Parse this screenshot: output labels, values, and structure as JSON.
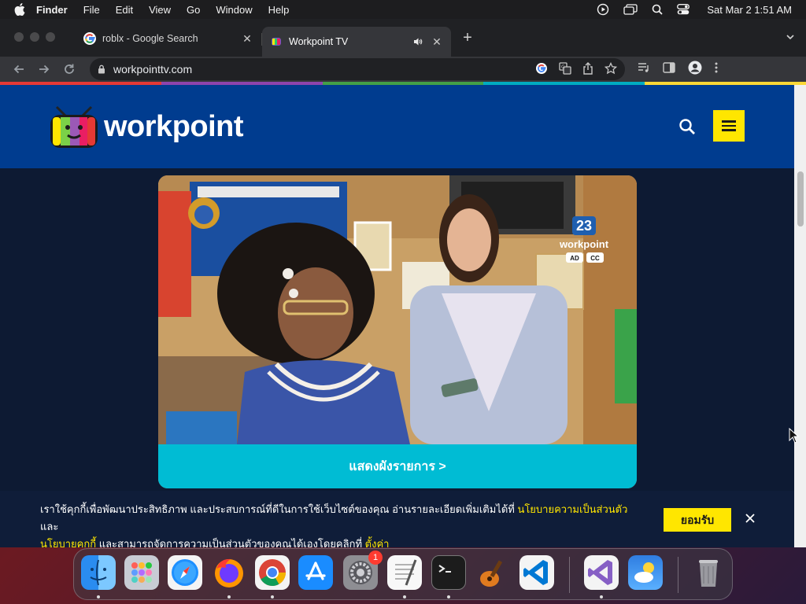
{
  "menubar": {
    "app_name": "Finder",
    "items": [
      "File",
      "Edit",
      "View",
      "Go",
      "Window",
      "Help"
    ],
    "clock": "Sat Mar 2  1:51 AM",
    "status_icons": [
      "play-circle-icon",
      "screen-mirror-icon",
      "search-icon",
      "control-center-icon"
    ]
  },
  "browser": {
    "tabs": [
      {
        "title": "roblx - Google Search",
        "favicon": "google-icon",
        "active": false
      },
      {
        "title": "Workpoint TV",
        "favicon": "workpoint-icon",
        "active": true,
        "audio": true
      }
    ],
    "url": "workpointtv.com"
  },
  "site": {
    "brand": "workpoint",
    "hero": {
      "channel_number": "23",
      "channel_name": "workpoint",
      "rating_ad": "AD",
      "rating_cc": "CC",
      "schedule_link": "แสดงผังรายการ >"
    },
    "cookie": {
      "text_1": "เราใช้คุกกี้เพื่อพัฒนาประสิทธิภาพ และประสบการณ์ที่ดีในการใช้เว็บไซต์ของคุณ อ่านรายละเอียดเพิ่มเติมได้ที่ ",
      "link_privacy": "นโยบายความเป็นส่วนตัว",
      "text_2": " และ",
      "link_cookie": "นโยบายคุกกี้",
      "text_3": " และสามารถจัดการความเป็นส่วนตัวของคุณได้เองโดยคลิกที่ ",
      "link_settings": "ตั้งค่า",
      "accept": "ยอมรับ"
    }
  },
  "dock": {
    "apps": [
      "finder",
      "launchpad",
      "safari",
      "firefox",
      "chrome",
      "app-store",
      "system-preferences",
      "textedit",
      "terminal",
      "instruments",
      "vscode",
      "visual-studio",
      "weather",
      "trash"
    ],
    "system_preferences_badge": "1"
  },
  "colors": {
    "header_blue": "#003c8f",
    "accent_yellow": "#ffe600",
    "schedule_cyan": "#00bcd4"
  }
}
